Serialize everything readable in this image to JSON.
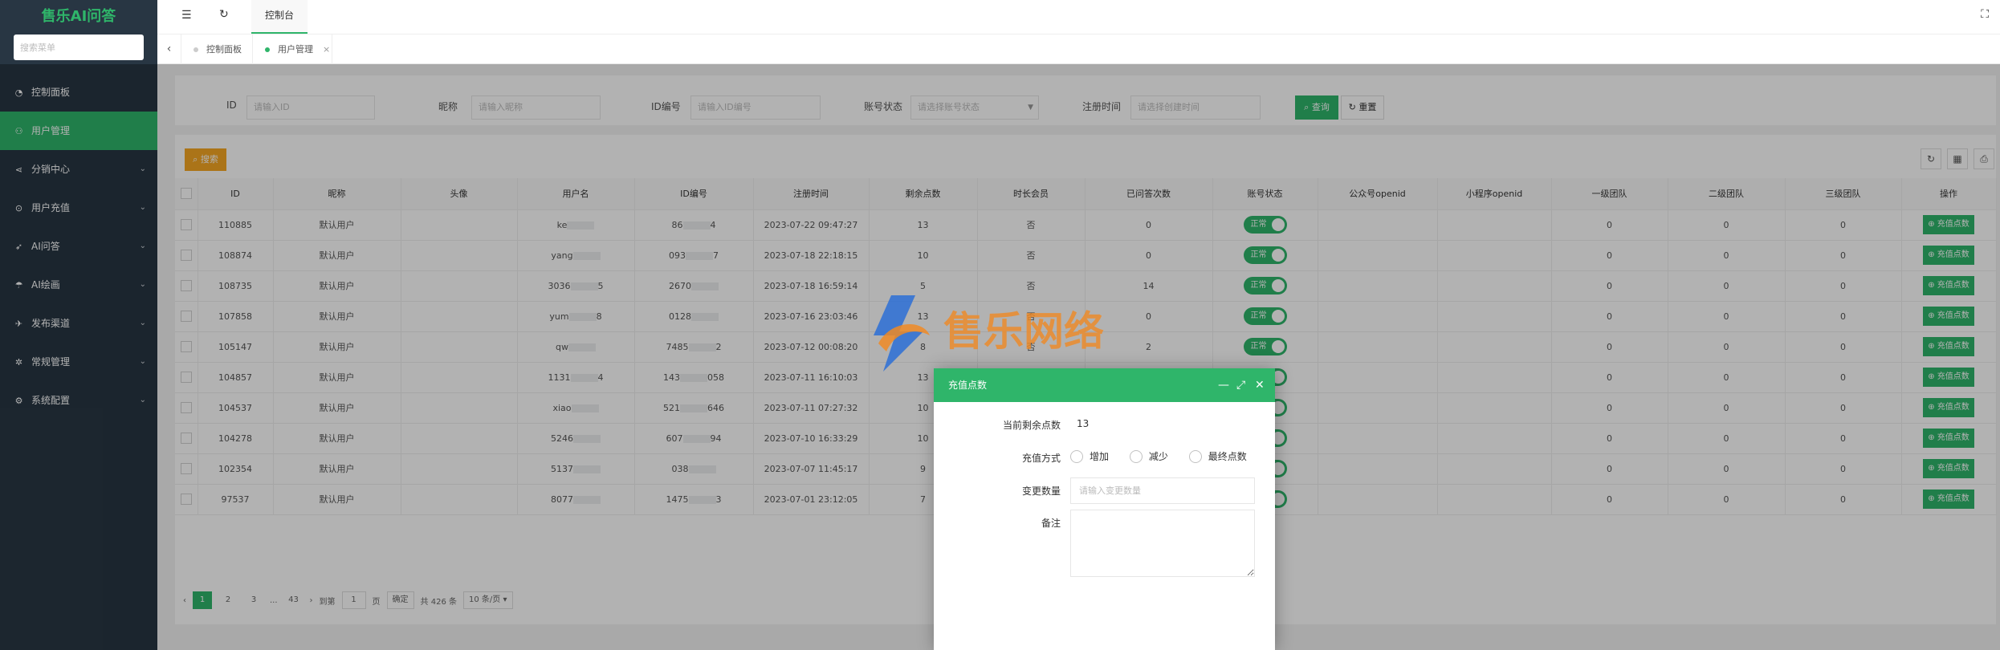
{
  "sidebar": {
    "brand": "售乐AI问答",
    "search_placeholder": "搜索菜单",
    "items": [
      {
        "label": "控制面板",
        "icon": "dashboard-icon"
      },
      {
        "label": "用户管理",
        "icon": "user-icon"
      },
      {
        "label": "分销中心",
        "icon": "share-icon"
      },
      {
        "label": "用户充值",
        "icon": "recharge-icon"
      },
      {
        "label": "AI问答",
        "icon": "send-icon"
      },
      {
        "label": "AI绘画",
        "icon": "paint-icon"
      },
      {
        "label": "发布渠道",
        "icon": "channel-icon"
      },
      {
        "label": "常规管理",
        "icon": "settings-icon"
      },
      {
        "label": "系统配置",
        "icon": "gear-icon"
      }
    ]
  },
  "header": {
    "tab": "控制台"
  },
  "page_tabs": [
    {
      "label": "控制面板"
    },
    {
      "label": "用户管理"
    }
  ],
  "filters": {
    "id_label": "ID",
    "id_placeholder": "请输入ID",
    "nick_label": "昵称",
    "nick_placeholder": "请输入昵称",
    "idno_label": "ID编号",
    "idno_placeholder": "请输入ID编号",
    "status_label": "账号状态",
    "status_placeholder": "请选择账号状态",
    "regtime_label": "注册时间",
    "regtime_placeholder": "请选择创建时间",
    "search_btn": "查询",
    "reset_btn": "重置"
  },
  "toolbar": {
    "add_btn": "搜索"
  },
  "table": {
    "columns": [
      "ID",
      "昵称",
      "头像",
      "用户名",
      "ID编号",
      "注册时间",
      "剩余点数",
      "时长会员",
      "已问答次数",
      "账号状态",
      "公众号openid",
      "小程序openid",
      "一级团队",
      "二级团队",
      "三级团队",
      "操作"
    ],
    "status_label": "正常",
    "action_label": "充值点数",
    "rows": [
      {
        "id": "110885",
        "nick": "默认用户",
        "username": "ke",
        "idno": "86",
        "idno_tail": "4",
        "regtime": "2023-07-22 09:47:27",
        "points": "13",
        "member": "否",
        "answers": "0",
        "t1": "0",
        "t2": "0",
        "t3": "0"
      },
      {
        "id": "108874",
        "nick": "默认用户",
        "username": "yang",
        "idno": "093",
        "idno_tail": "7",
        "regtime": "2023-07-18 22:18:15",
        "points": "10",
        "member": "否",
        "answers": "0",
        "t1": "0",
        "t2": "0",
        "t3": "0"
      },
      {
        "id": "108735",
        "nick": "默认用户",
        "username": "3036",
        "username_tail": "5",
        "idno": "2670",
        "idno_tail": "",
        "regtime": "2023-07-18 16:59:14",
        "points": "5",
        "member": "否",
        "answers": "14",
        "t1": "0",
        "t2": "0",
        "t3": "0"
      },
      {
        "id": "107858",
        "nick": "默认用户",
        "username": "yum",
        "username_tail": "8",
        "idno": "0128",
        "idno_tail": "",
        "regtime": "2023-07-16 23:03:46",
        "points": "13",
        "member": "否",
        "answers": "0",
        "t1": "0",
        "t2": "0",
        "t3": "0"
      },
      {
        "id": "105147",
        "nick": "默认用户",
        "username": "qw",
        "idno": "7485",
        "idno_tail": "2",
        "regtime": "2023-07-12 00:08:20",
        "points": "8",
        "member": "否",
        "answers": "2",
        "t1": "0",
        "t2": "0",
        "t3": "0"
      },
      {
        "id": "104857",
        "nick": "默认用户",
        "username": "1131",
        "username_tail": "4",
        "idno": "143",
        "idno_tail": "058",
        "regtime": "2023-07-11 16:10:03",
        "points": "13",
        "member": "",
        "answers": "",
        "t1": "0",
        "t2": "0",
        "t3": "0"
      },
      {
        "id": "104537",
        "nick": "默认用户",
        "username": "xiao",
        "idno": "521",
        "idno_tail": "646",
        "regtime": "2023-07-11 07:27:32",
        "points": "10",
        "member": "",
        "answers": "",
        "t1": "0",
        "t2": "0",
        "t3": "0"
      },
      {
        "id": "104278",
        "nick": "默认用户",
        "username": "5246",
        "idno": "607",
        "idno_tail": "94",
        "regtime": "2023-07-10 16:33:29",
        "points": "10",
        "member": "",
        "answers": "",
        "t1": "0",
        "t2": "0",
        "t3": "0"
      },
      {
        "id": "102354",
        "nick": "默认用户",
        "username": "5137",
        "idno": "038",
        "idno_tail": "",
        "regtime": "2023-07-07 11:45:17",
        "points": "9",
        "member": "",
        "answers": "",
        "t1": "0",
        "t2": "0",
        "t3": "0"
      },
      {
        "id": "97537",
        "nick": "默认用户",
        "username": "8077",
        "idno": "1475",
        "idno_tail": "3",
        "regtime": "2023-07-01 23:12:05",
        "points": "7",
        "member": "",
        "answers": "",
        "t1": "0",
        "t2": "0",
        "t3": "0"
      }
    ]
  },
  "pager": {
    "pages": [
      "1",
      "2",
      "3",
      "...",
      "43"
    ],
    "goto_label": "到第",
    "goto_value": "1",
    "page_unit": "页",
    "confirm": "确定",
    "total": "共 426 条",
    "size": "10 条/页"
  },
  "watermark": {
    "text": "售乐网络"
  },
  "dialog": {
    "title": "充值点数",
    "current_label": "当前剩余点数",
    "current_value": "13",
    "method_label": "充值方式",
    "method_options": [
      "增加",
      "减少",
      "最终点数"
    ],
    "qty_label": "变更数量",
    "qty_placeholder": "请输入变更数量",
    "note_label": "备注"
  },
  "colors": {
    "sidebar_bg": "#283643",
    "accent": "#2fb56a",
    "warn": "#f5a623"
  }
}
